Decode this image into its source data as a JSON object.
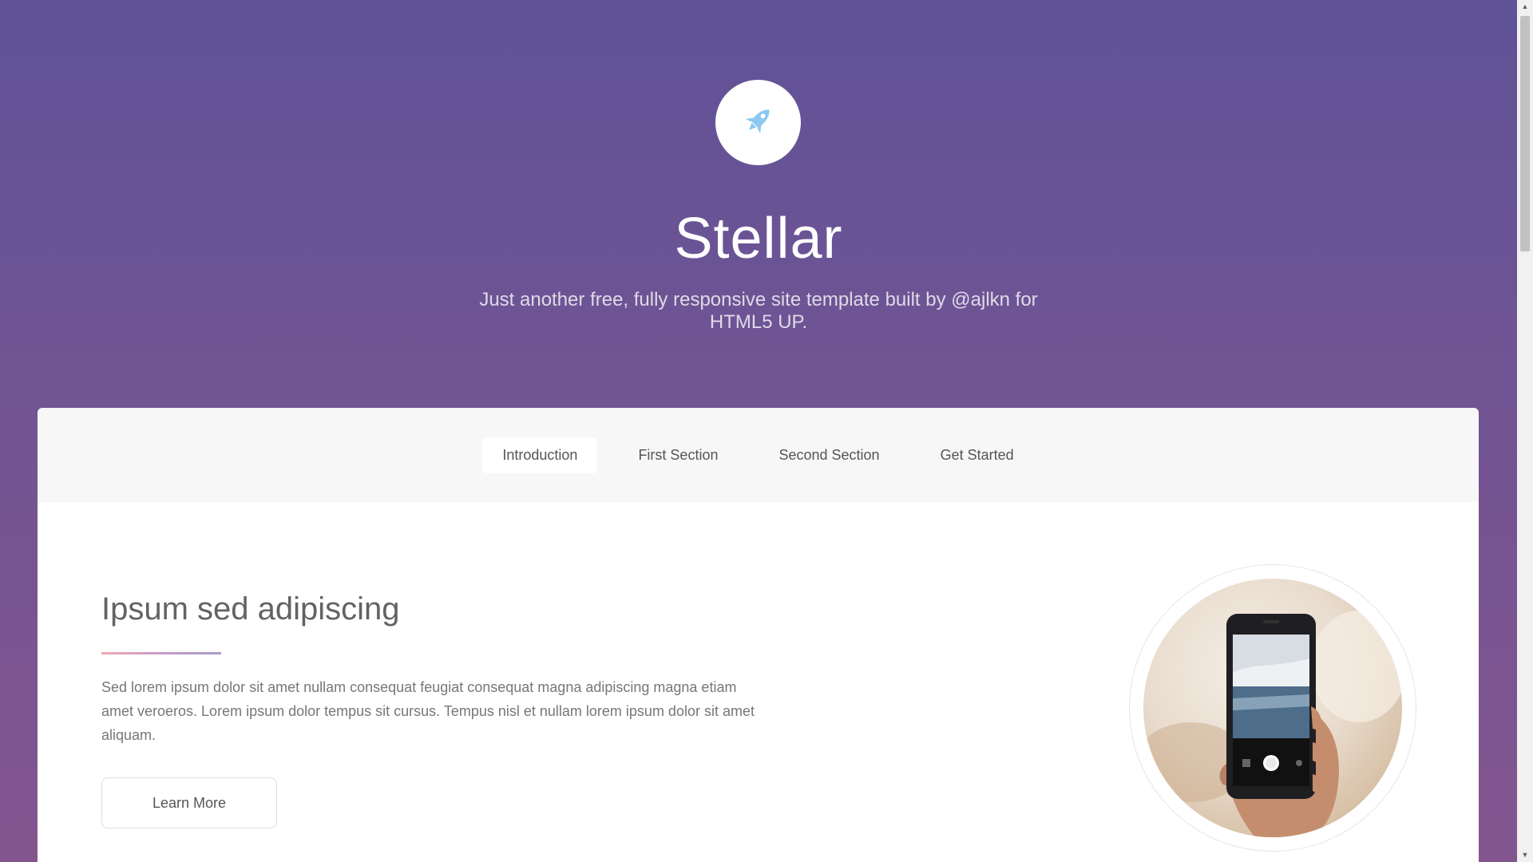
{
  "header": {
    "logo_icon": "rocket-icon",
    "title": "Stellar",
    "tagline": "Just another free, fully responsive site template built by @ajlkn for HTML5 UP."
  },
  "nav": {
    "items": [
      {
        "label": "Introduction",
        "active": true
      },
      {
        "label": "First Section",
        "active": false
      },
      {
        "label": "Second Section",
        "active": false
      },
      {
        "label": "Get Started",
        "active": false
      }
    ]
  },
  "intro": {
    "title": "Ipsum sed adipiscing",
    "body": "Sed lorem ipsum dolor sit amet nullam consequat feugiat consequat magna adipiscing magna etiam amet veroeros. Lorem ipsum dolor tempus sit cursus. Tempus nisl et nullam lorem ipsum dolor sit amet aliquam.",
    "button_label": "Learn More"
  },
  "colors": {
    "gradient_top": "#5f5297",
    "gradient_bottom": "#83558f",
    "rocket": "#8cc9f0",
    "divider_start": "#efa8b0",
    "divider_end": "#a89cc8"
  }
}
